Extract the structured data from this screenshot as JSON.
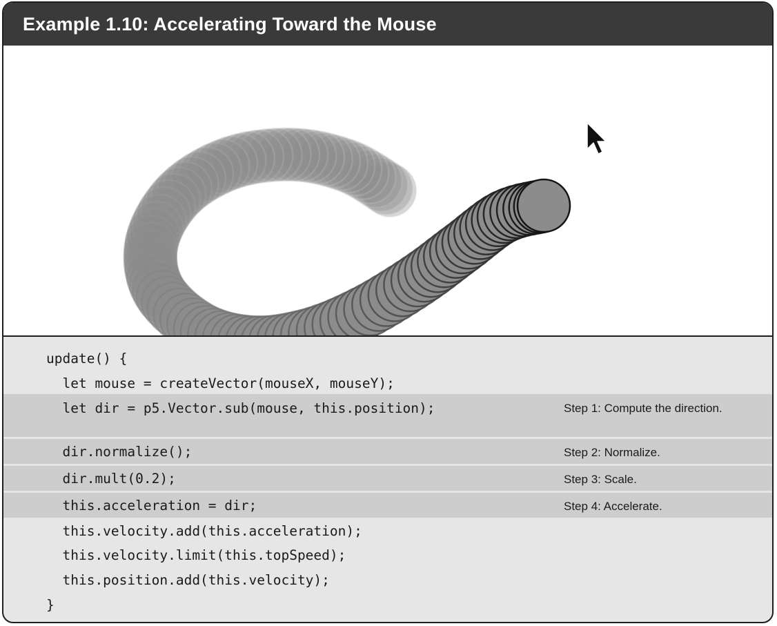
{
  "title": "Example 1.10: Accelerating Toward the Mouse",
  "canvas": {
    "cursor_icon": "arrow-cursor-icon"
  },
  "code": {
    "lines": [
      "update() {",
      "  let mouse = createVector(mouseX, mouseY);",
      "  let dir = p5.Vector.sub(mouse, this.position);",
      "  dir.normalize();",
      "  dir.mult(0.2);",
      "  this.acceleration = dir;",
      "  this.velocity.add(this.acceleration);",
      "  this.velocity.limit(this.topSpeed);",
      "  this.position.add(this.velocity);",
      "}"
    ],
    "notes": {
      "step1": "Step 1: Compute the direction.",
      "step2": "Step 2: Normalize.",
      "step3": "Step 3: Scale.",
      "step4": "Step 4: Accelerate."
    }
  },
  "colors": {
    "title_bar": "#3a3a3a",
    "code_bg": "#e6e6e6",
    "highlight_bg": "#cdcdcd"
  }
}
